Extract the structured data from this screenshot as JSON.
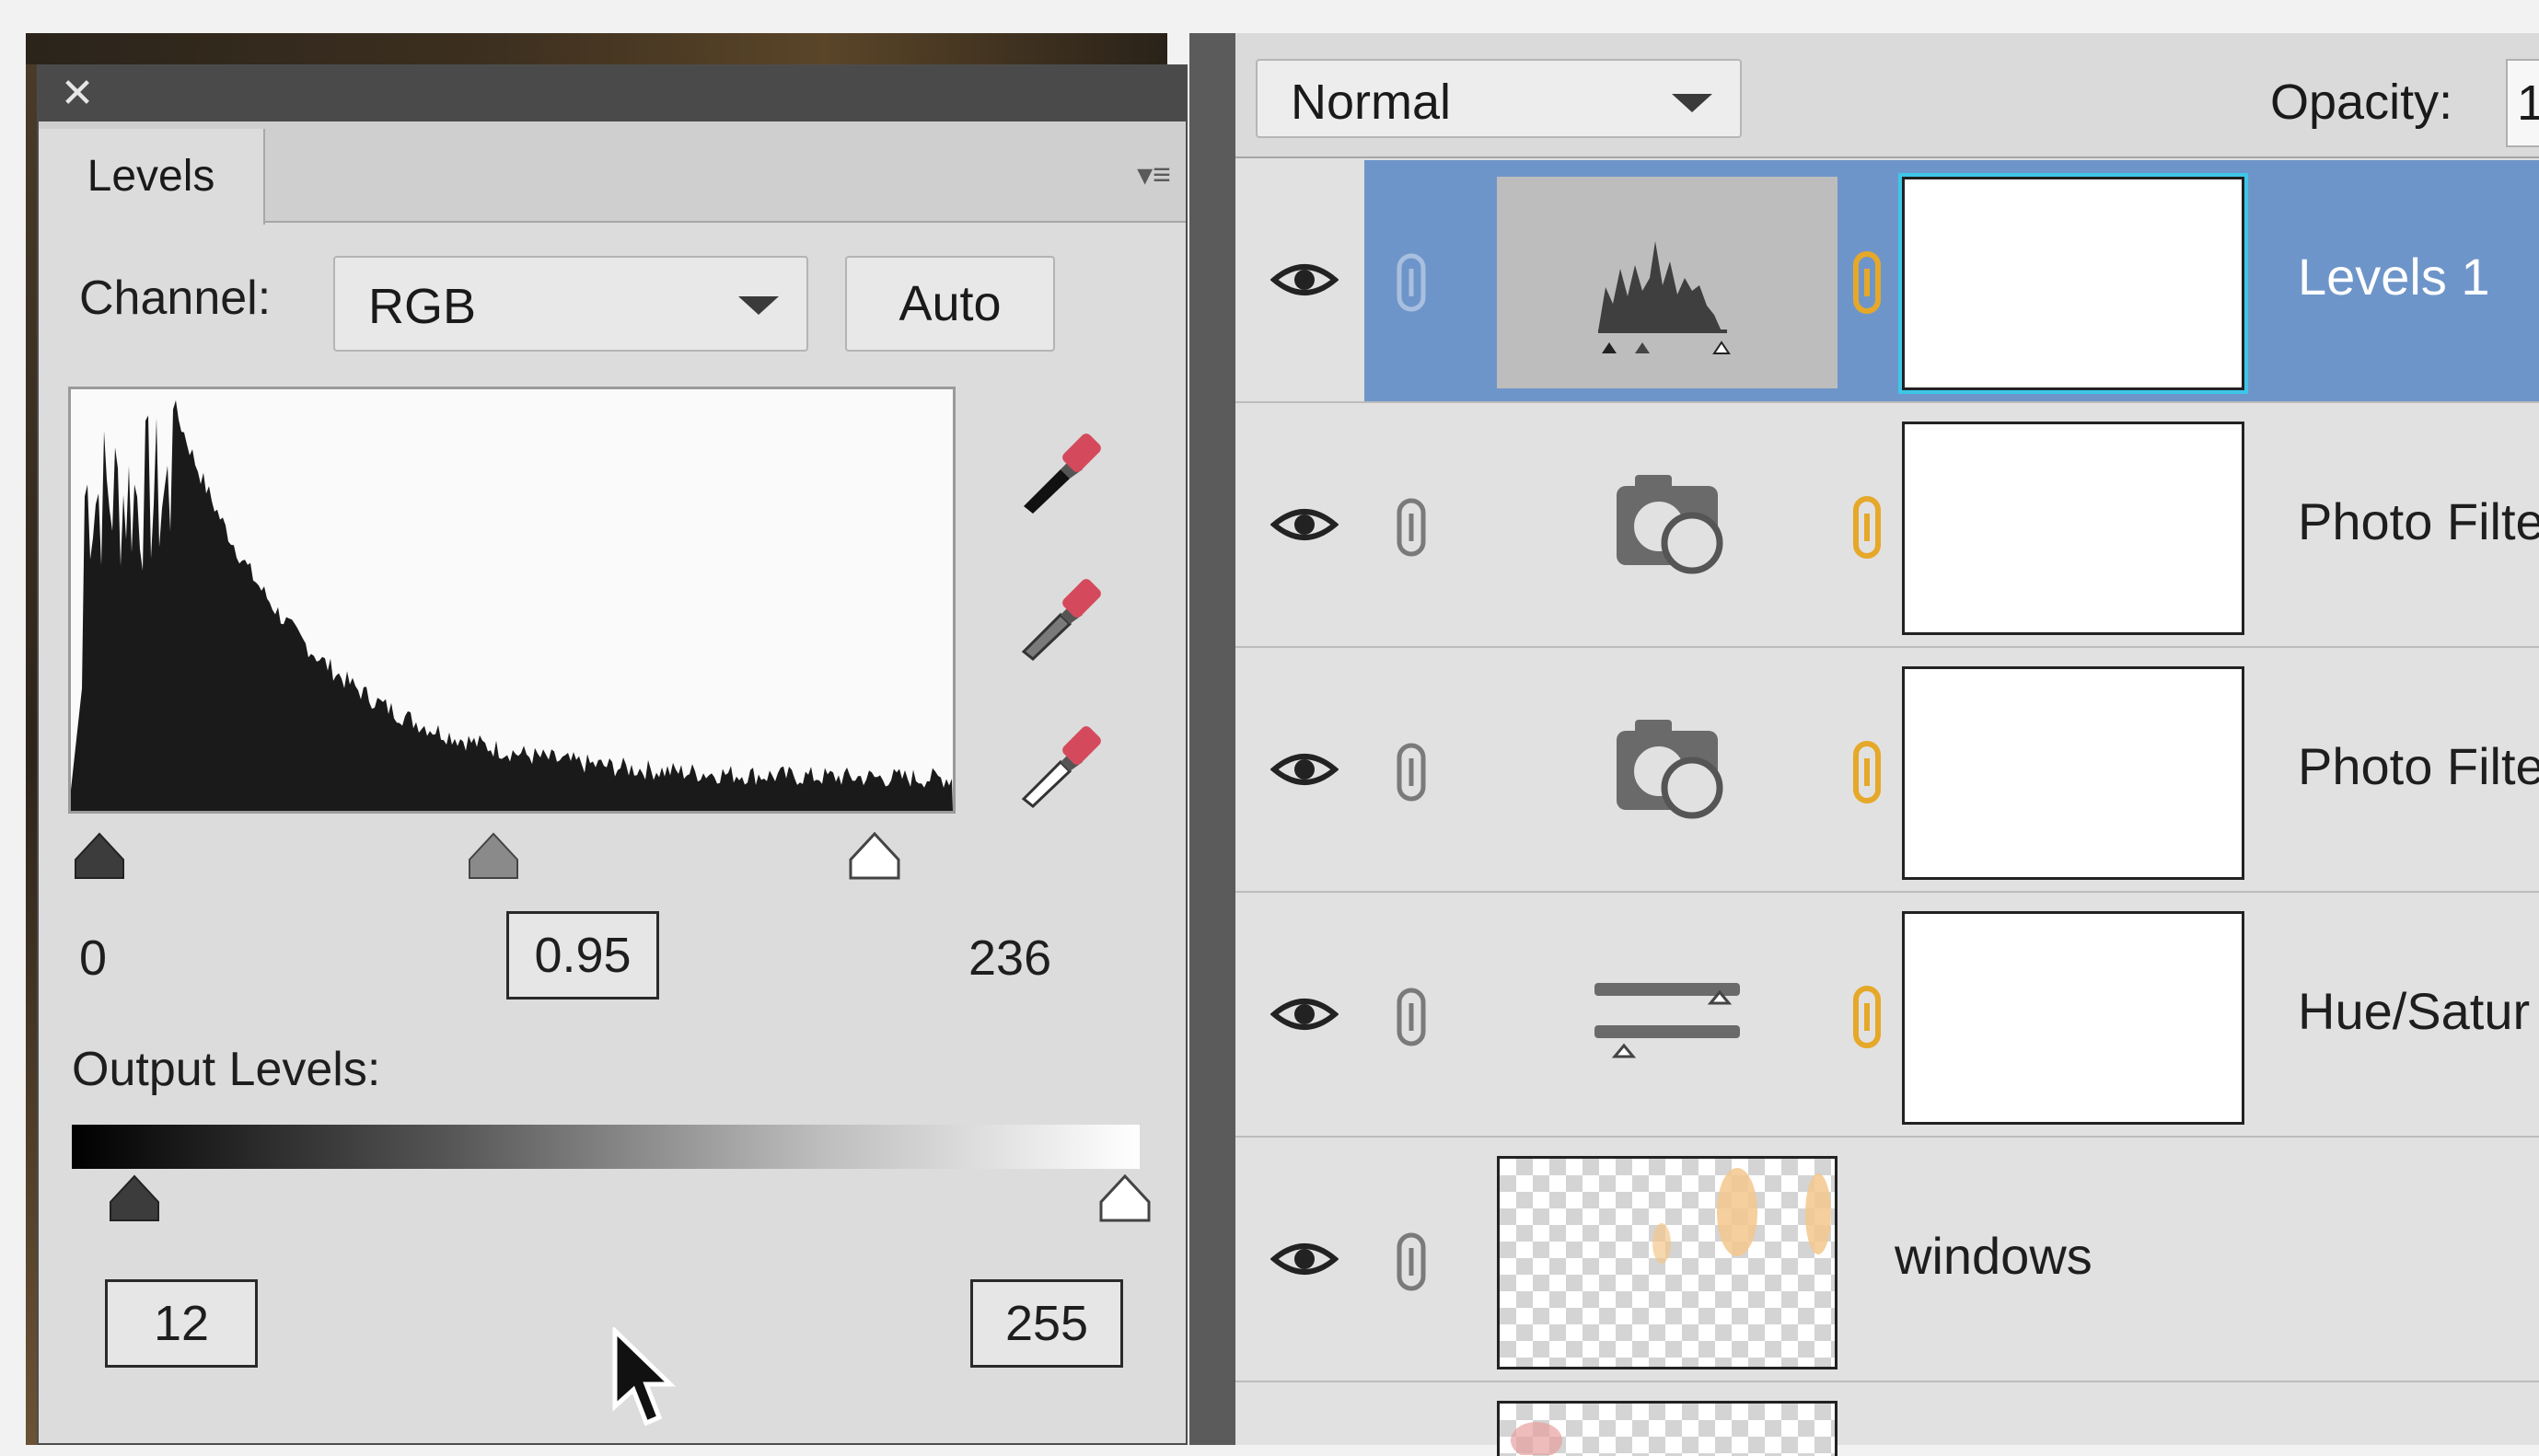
{
  "levels_panel": {
    "close_glyph": "✕",
    "tab_label": "Levels",
    "channel_label": "Channel:",
    "channel_value": "RGB",
    "auto_label": "Auto",
    "input_black": "0",
    "input_gray": "0.95",
    "input_white": "236",
    "output_label": "Output Levels:",
    "output_black": "12",
    "output_white": "255",
    "eyedroppers": [
      "black-point-eyedropper-icon",
      "gray-point-eyedropper-icon",
      "white-point-eyedropper-icon"
    ]
  },
  "layers_panel": {
    "blend_mode": "Normal",
    "opacity_label": "Opacity:",
    "opacity_value": "1",
    "layers": [
      {
        "name": "Levels 1",
        "selected": true,
        "thumb_icon": "levels-histogram-icon"
      },
      {
        "name": "Photo Filte",
        "selected": false,
        "thumb_icon": "photo-filter-icon"
      },
      {
        "name": "Photo Filte",
        "selected": false,
        "thumb_icon": "photo-filter-icon"
      },
      {
        "name": "Hue/Satur",
        "selected": false,
        "thumb_icon": "hue-saturation-icon"
      },
      {
        "name": "windows",
        "selected": false,
        "thumb_icon": "transparent-thumbnail"
      }
    ]
  },
  "colors": {
    "selected_row": "#6e95c9",
    "panel_bg": "#dcdcdc",
    "mask_highlight": "#3ec6e8",
    "chain_accent": "#e6a829"
  }
}
